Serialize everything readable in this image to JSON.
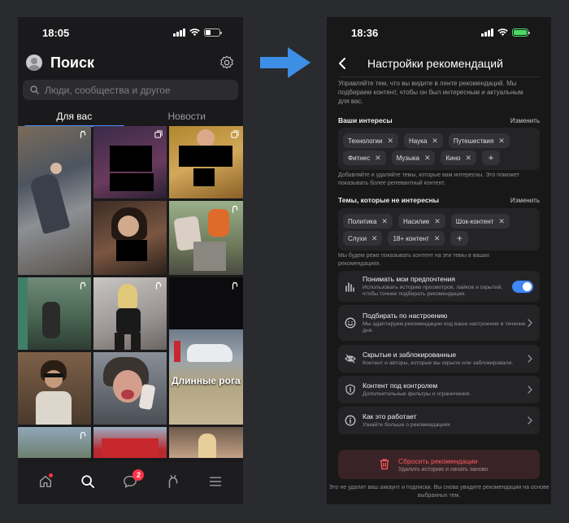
{
  "left": {
    "status_time": "18:05",
    "title": "Поиск",
    "search_placeholder": "Люди, сообщества и другое",
    "tabs": [
      "Для вас",
      "Новости"
    ],
    "grid_overlay_text": "Длинные рога",
    "nav_badge_count": "2"
  },
  "right": {
    "status_time": "18:36",
    "title": "Настройки рекомендаций",
    "intro": "Управляйте тем, что вы видите в ленте рекомендаций. Мы подбираем контент, чтобы он был интересным и актуальным для вас.",
    "interests": {
      "heading": "Ваши интересы",
      "action": "Изменить",
      "row1": [
        "Технологии",
        "Наука",
        "Путешествия"
      ],
      "row2": [
        "Фитнес",
        "Музыка",
        "Кино"
      ],
      "hint": "Добавляйте и удаляйте темы, которые вам интересны. Это поможет показывать более релевантный контент."
    },
    "not_interested": {
      "heading": "Темы, которые не интересны",
      "action": "Изменить",
      "row1": [
        "Политика",
        "Насилие",
        "Шок-контент"
      ],
      "row2": [
        "Слухи",
        "18+ контент"
      ],
      "hint": "Мы будем реже показывать контент на эти темы в ваших рекомендациях."
    },
    "rows": [
      {
        "title": "Понимать мои предпочтения",
        "subtitle": "Использовать историю просмотров, лайков и скрытий, чтобы точнее подбирать рекомендации.",
        "toggle_on": true
      },
      {
        "title": "Подбирать по настроению",
        "subtitle": "Мы адаптируем рекомендации под ваше настроение в течение дня."
      },
      {
        "title": "Скрытые и заблокированные",
        "subtitle": "Контент и авторы, которые вы скрыли или заблокировали."
      },
      {
        "title": "Контент под контролем",
        "subtitle": "Дополнительные фильтры и ограничения."
      },
      {
        "title": "Как это работает",
        "subtitle": "Узнайте больше о рекомендациях"
      }
    ],
    "reset": {
      "title": "Сбросить рекомендации",
      "subtitle": "Удалить историю и начать заново"
    },
    "footnote": "Это не удалит ваш аккаунт и подписки. Вы снова увидите рекомендации на основе выбранных тем."
  },
  "colors": {
    "accent": "#3f86f7",
    "danger": "#ff5a5f",
    "arrow": "#3d8fe6"
  }
}
